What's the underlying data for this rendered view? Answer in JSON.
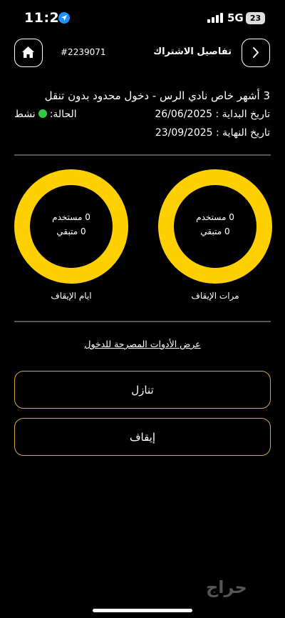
{
  "status_bar": {
    "time": "11:29",
    "network": "5G",
    "battery": "23"
  },
  "header": {
    "title": "تفاصيل الاشتراك",
    "subscription_id": "#2239071"
  },
  "subscription": {
    "plan": "3 أشهر خاص نادي الرس - دخول محدود بدون تنقل",
    "status_label": "الحالة:",
    "status_value": "نشط",
    "status_color": "#2ecc40",
    "start_date": "تاريخ البداية : 26/06/2025",
    "end_date": "تاريخ النهاية : 23/09/2025"
  },
  "stats": [
    {
      "used": "0 مستخدم",
      "remaining": "0 متبقي",
      "caption": "مرات الإيقاف"
    },
    {
      "used": "0 مستخدم",
      "remaining": "0 متبقي",
      "caption": "ايام الإيقاف"
    }
  ],
  "ring_color": "#ffd000",
  "tools_link": "عرض الأدوات المصرحة للدخول",
  "buttons": {
    "waive": "تنازل",
    "pause": "إيقاف"
  },
  "watermark": "حراج"
}
